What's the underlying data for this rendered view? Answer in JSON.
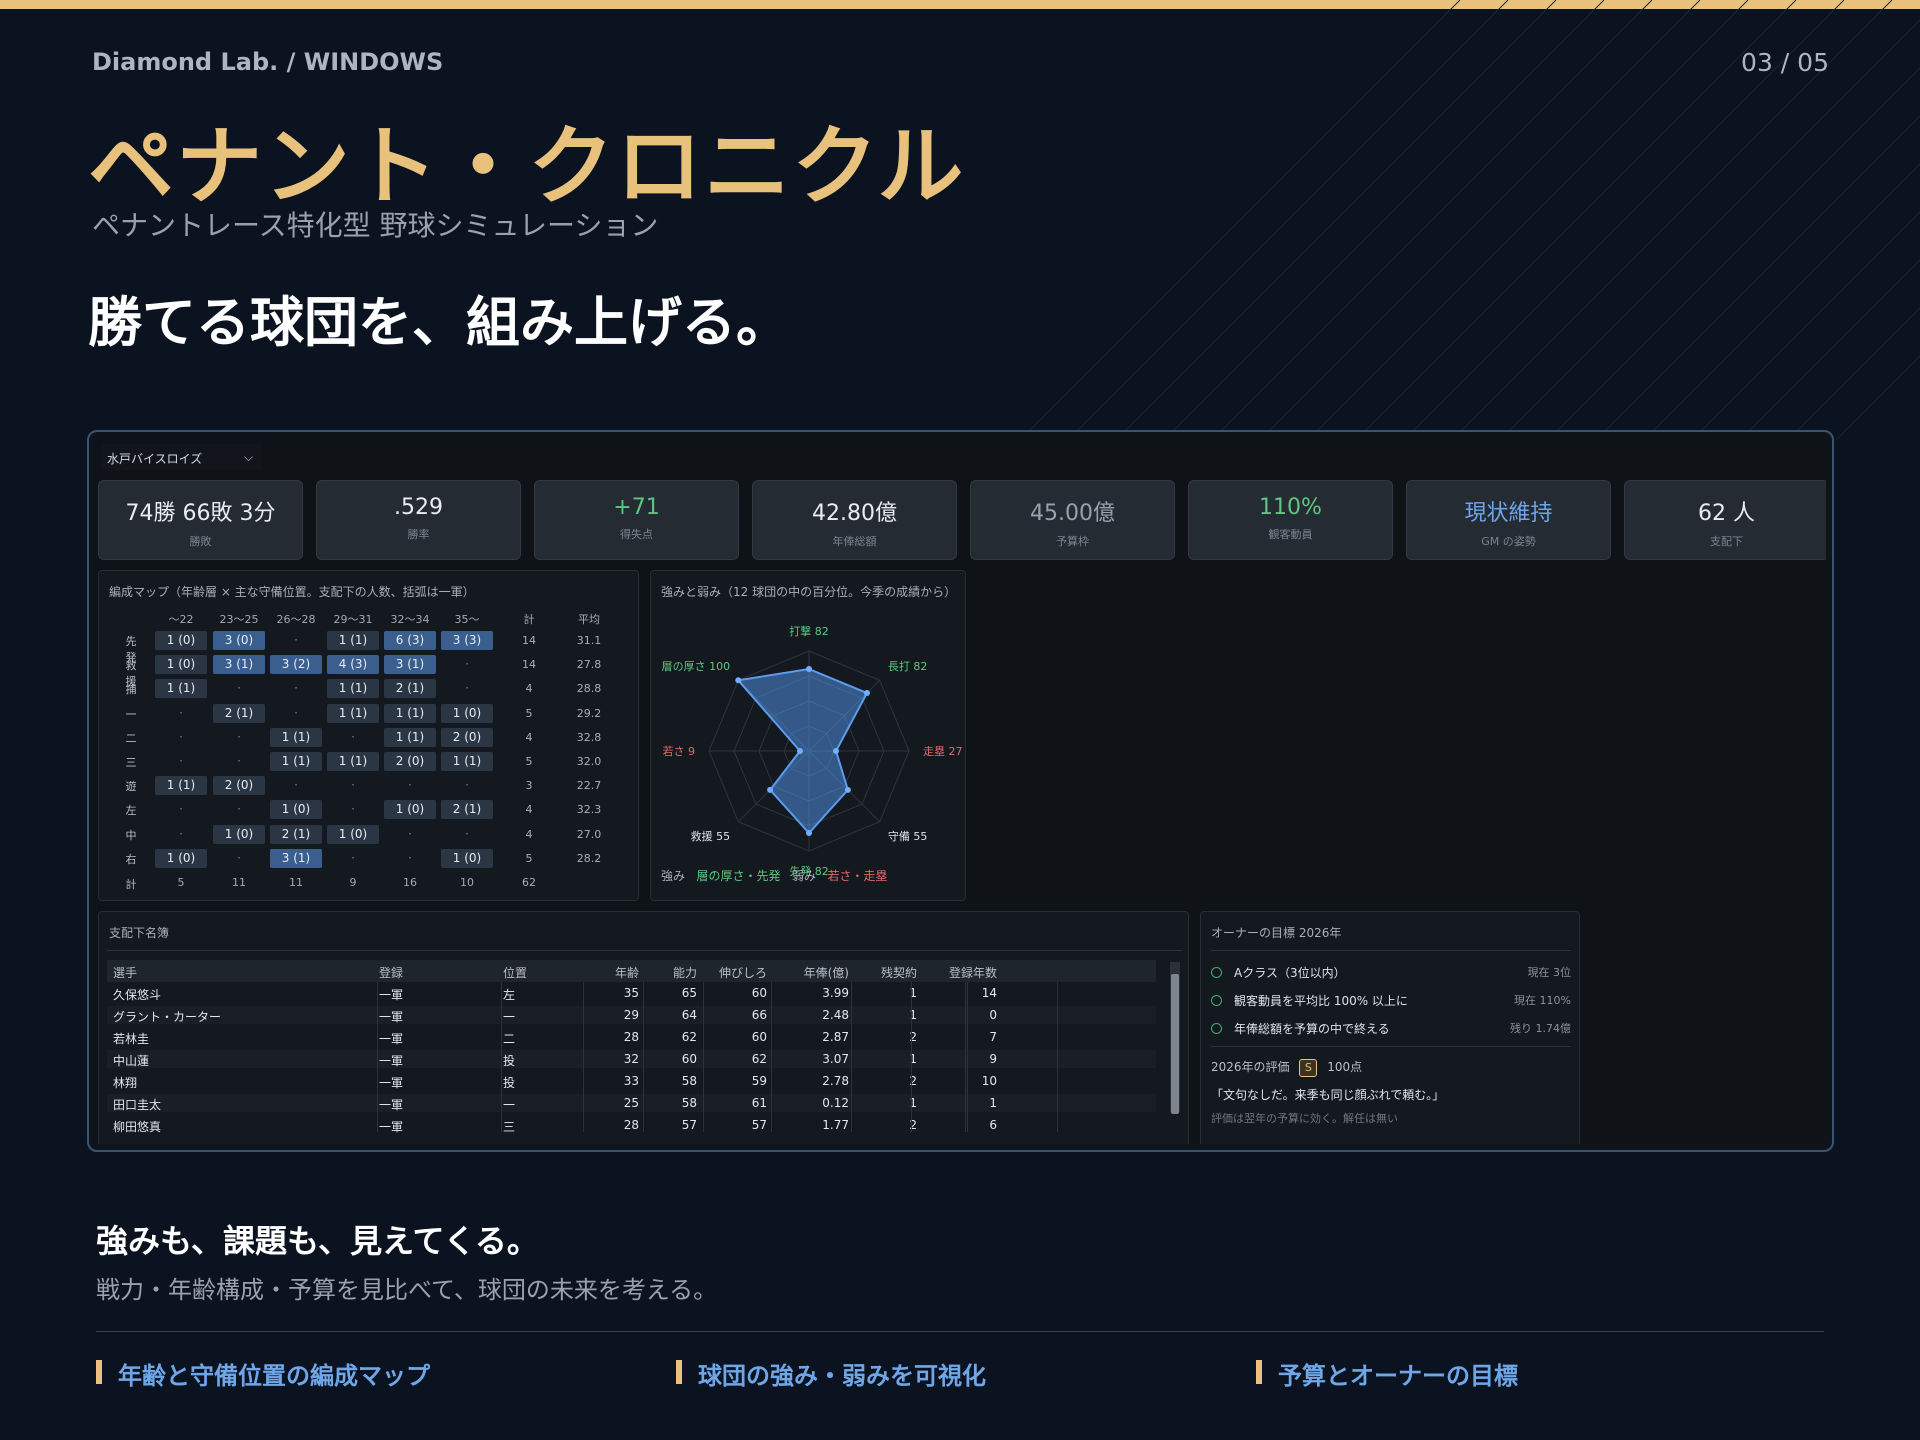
{
  "header": {
    "breadcrumb": "Diamond Lab.  /  WINDOWS",
    "page_number": "03 / 05",
    "title": "ペナント・クロニクル",
    "subtitle": "ペナントレース特化型 野球シミュレーション",
    "headline": "勝てる球団を、組み上げる。"
  },
  "app": {
    "team_select": "水戸バイスロイズ",
    "stats": [
      {
        "value": "74勝 66敗 3分",
        "label": "勝敗",
        "color": "#e9ecf0"
      },
      {
        "value": ".529",
        "label": "勝率",
        "color": "#e9ecf0"
      },
      {
        "value": "+71",
        "label": "得失点",
        "color": "#5cc87f"
      },
      {
        "value": "42.80億",
        "label": "年俸総額",
        "color": "#e9ecf0"
      },
      {
        "value": "45.00億",
        "label": "予算枠",
        "color": "#9aa1ad"
      },
      {
        "value": "110%",
        "label": "観客動員",
        "color": "#5cc87f"
      },
      {
        "value": "現状維持",
        "label": "GM の姿勢",
        "color": "#6fa6e8"
      },
      {
        "value": "62 人",
        "label": "支配下",
        "color": "#e9ecf0"
      }
    ],
    "roster_map": {
      "title": "編成マップ（年齢層 × 主な守備位置。支配下の人数、括弧は一軍）",
      "age_columns": [
        "〜22",
        "23〜25",
        "26〜28",
        "29〜31",
        "32〜34",
        "35〜"
      ],
      "total_header": "計",
      "avg_header": "平均",
      "rows": [
        {
          "pos": "先発",
          "cells": [
            "1 (0)",
            "3 (0)",
            "·",
            "1 (1)",
            "6 (3)",
            "3 (3)"
          ],
          "levels": [
            1,
            2,
            0,
            1,
            2,
            2
          ],
          "total": "14",
          "avg": "31.1"
        },
        {
          "pos": "救援",
          "cells": [
            "1 (0)",
            "3 (1)",
            "3 (2)",
            "4 (3)",
            "3 (1)",
            "·"
          ],
          "levels": [
            1,
            2,
            2,
            2,
            2,
            0
          ],
          "total": "14",
          "avg": "27.8"
        },
        {
          "pos": "捕",
          "cells": [
            "1 (1)",
            "·",
            "·",
            "1 (1)",
            "2 (1)",
            "·"
          ],
          "levels": [
            1,
            0,
            0,
            1,
            1,
            0
          ],
          "total": "4",
          "avg": "28.8"
        },
        {
          "pos": "一",
          "cells": [
            "·",
            "2 (1)",
            "·",
            "1 (1)",
            "1 (1)",
            "1 (0)"
          ],
          "levels": [
            0,
            1,
            0,
            1,
            1,
            1
          ],
          "total": "5",
          "avg": "29.2"
        },
        {
          "pos": "二",
          "cells": [
            "·",
            "·",
            "1 (1)",
            "·",
            "1 (1)",
            "2 (0)"
          ],
          "levels": [
            0,
            0,
            1,
            0,
            1,
            1
          ],
          "total": "4",
          "avg": "32.8"
        },
        {
          "pos": "三",
          "cells": [
            "·",
            "·",
            "1 (1)",
            "1 (1)",
            "2 (0)",
            "1 (1)"
          ],
          "levels": [
            0,
            0,
            1,
            1,
            1,
            1
          ],
          "total": "5",
          "avg": "32.0"
        },
        {
          "pos": "遊",
          "cells": [
            "1 (1)",
            "2 (0)",
            "·",
            "·",
            "·",
            "·"
          ],
          "levels": [
            1,
            1,
            0,
            0,
            0,
            0
          ],
          "total": "3",
          "avg": "22.7"
        },
        {
          "pos": "左",
          "cells": [
            "·",
            "·",
            "1 (0)",
            "·",
            "1 (0)",
            "2 (1)"
          ],
          "levels": [
            0,
            0,
            1,
            0,
            1,
            1
          ],
          "total": "4",
          "avg": "32.3"
        },
        {
          "pos": "中",
          "cells": [
            "·",
            "1 (0)",
            "2 (1)",
            "1 (0)",
            "·",
            "·"
          ],
          "levels": [
            0,
            1,
            1,
            1,
            0,
            0
          ],
          "total": "4",
          "avg": "27.0"
        },
        {
          "pos": "右",
          "cells": [
            "1 (0)",
            "·",
            "3 (1)",
            "·",
            "·",
            "1 (0)"
          ],
          "levels": [
            1,
            0,
            2,
            0,
            0,
            1
          ],
          "total": "5",
          "avg": "28.2"
        }
      ],
      "sum_row": {
        "label": "計",
        "values": [
          "5",
          "11",
          "11",
          "9",
          "16",
          "10"
        ],
        "total": "62"
      }
    },
    "radar": {
      "title": "強みと弱み（12 球団の中の百分位。今季の成績から）",
      "axes": [
        {
          "label": "打撃 82",
          "value": 82,
          "color": "#5cc87f"
        },
        {
          "label": "長打 82",
          "value": 82,
          "color": "#5cc87f"
        },
        {
          "label": "走塁 27",
          "value": 27,
          "color": "#e06a6a"
        },
        {
          "label": "守備 55",
          "value": 55,
          "color": "#dfe3e8"
        },
        {
          "label": "先発 82",
          "value": 82,
          "color": "#5cc87f"
        },
        {
          "label": "救援 55",
          "value": 55,
          "color": "#dfe3e8"
        },
        {
          "label": "若さ 9",
          "value": 9,
          "color": "#e06a6a"
        },
        {
          "label": "層の厚さ 100",
          "value": 100,
          "color": "#5cc87f"
        }
      ],
      "strengths_label": "強み",
      "strengths": "層の厚さ・先発",
      "weaknesses_label": "弱み",
      "weaknesses": "若さ・走塁"
    },
    "roster_table": {
      "title": "支配下名簿",
      "columns": [
        "選手",
        "登録",
        "位置",
        "年齢",
        "能力",
        "伸びしろ",
        "年俸(億)",
        "残契約",
        "登録年数"
      ],
      "rows": [
        [
          "久保悠斗",
          "一軍",
          "左",
          "35",
          "65",
          "60",
          "3.99",
          "1",
          "14"
        ],
        [
          "グラント・カーター",
          "一軍",
          "一",
          "29",
          "64",
          "66",
          "2.48",
          "1",
          "0"
        ],
        [
          "若林圭",
          "一軍",
          "二",
          "28",
          "62",
          "60",
          "2.87",
          "2",
          "7"
        ],
        [
          "中山蓮",
          "一軍",
          "投",
          "32",
          "60",
          "62",
          "3.07",
          "1",
          "9"
        ],
        [
          "林翔",
          "一軍",
          "投",
          "33",
          "58",
          "59",
          "2.78",
          "2",
          "10"
        ],
        [
          "田口圭太",
          "一軍",
          "一",
          "25",
          "58",
          "61",
          "0.12",
          "1",
          "1"
        ],
        [
          "柳田悠真",
          "一軍",
          "三",
          "28",
          "57",
          "57",
          "1.77",
          "2",
          "6"
        ]
      ]
    },
    "owner_goals": {
      "title": "オーナーの目標 2026年",
      "goals": [
        {
          "text": "Aクラス（3位以内）",
          "status": "現在 3位"
        },
        {
          "text": "観客動員を平均比 100% 以上に",
          "status": "現在 110%"
        },
        {
          "text": "年俸総額を予算の中で終える",
          "status": "残り 1.74億"
        }
      ],
      "eval_label": "2026年の評価",
      "eval_grade": "S",
      "eval_points": "100点",
      "quote": "「文句なしだ。来季も同じ顔ぶれで頼む。」",
      "note": "評価は翌年の予算に効く。解任は無い"
    }
  },
  "bottom": {
    "heading": "強みも、課題も、見えてくる。",
    "sub": "戦力・年齢構成・予算を見比べて、球団の未来を考える。",
    "features": [
      "年齢と守備位置の編成マップ",
      "球団の強み・弱みを可視化",
      "予算とオーナーの目標"
    ]
  },
  "colors": {
    "accent": "#e8c27c",
    "link": "#6fa6e8",
    "good": "#5cc87f",
    "bad": "#e06a6a"
  }
}
